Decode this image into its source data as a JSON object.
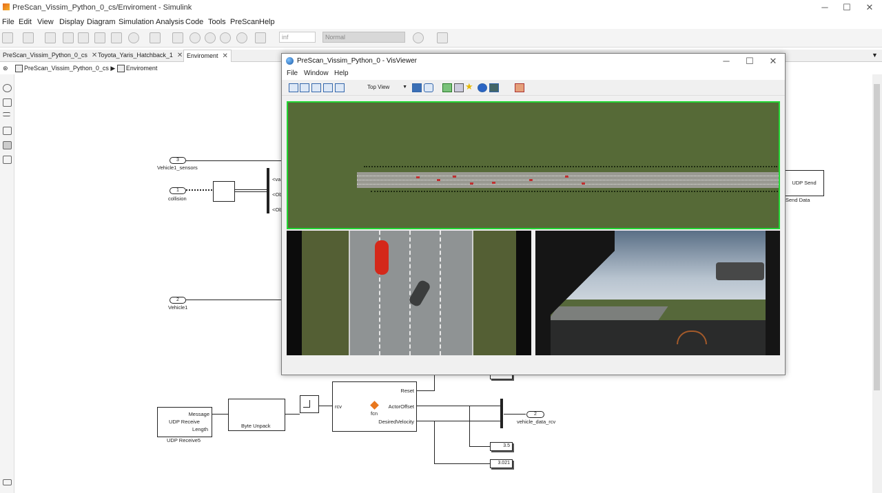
{
  "window": {
    "title": "PreScan_Vissim_Python_0_cs/Enviroment - Simulink",
    "controls": [
      "─",
      "☐",
      "✕"
    ]
  },
  "menu": [
    "File",
    "Edit",
    "View",
    "Display",
    "Diagram",
    "Simulation",
    "Analysis",
    "Code",
    "Tools",
    "PreScan",
    "Help"
  ],
  "toolbar": {
    "stop_time": "inf",
    "sim_mode": "Normal"
  },
  "tabs": [
    {
      "label": "PreScan_Vissim_Python_0_cs",
      "active": false
    },
    {
      "label": "Toyota_Yaris_Hatchback_1",
      "active": false
    },
    {
      "label": "Enviroment",
      "active": true
    }
  ],
  "breadcrumb": [
    "PreScan_Vissim_Python_0_cs",
    "Enviroment"
  ],
  "diagram": {
    "inport_3": {
      "num": "3",
      "label": "Vehicle1_sensors"
    },
    "inport_1": {
      "num": "1",
      "label": "collision"
    },
    "inport_2": {
      "num": "2",
      "label": "Vehicle1"
    },
    "bus_labels": [
      "<va",
      "<Obj",
      "<Obj"
    ],
    "udp_send": {
      "text": "UDP Send",
      "label": "Send Data"
    },
    "udp_receive": {
      "lines": [
        "Message",
        "UDP Receive",
        "Length"
      ],
      "label": "UDP Receive5"
    },
    "byte_unpack": {
      "text": "Byte Unpack"
    },
    "fcn_block": {
      "in": "rcv",
      "center": "fcn",
      "outs": [
        "Reset",
        "ActorOffset",
        "DesiredVelocity"
      ]
    },
    "outport_2": {
      "num": "2",
      "label": "vehicle_data_rcv"
    },
    "display_1": "3.5",
    "display_2": "3.021"
  },
  "visviewer": {
    "title": "PreScan_Vissim_Python_0 - VisViewer",
    "controls": [
      "─",
      "☐",
      "✕"
    ],
    "menu": [
      "File",
      "Window",
      "Help"
    ],
    "view_select": "Top View"
  }
}
